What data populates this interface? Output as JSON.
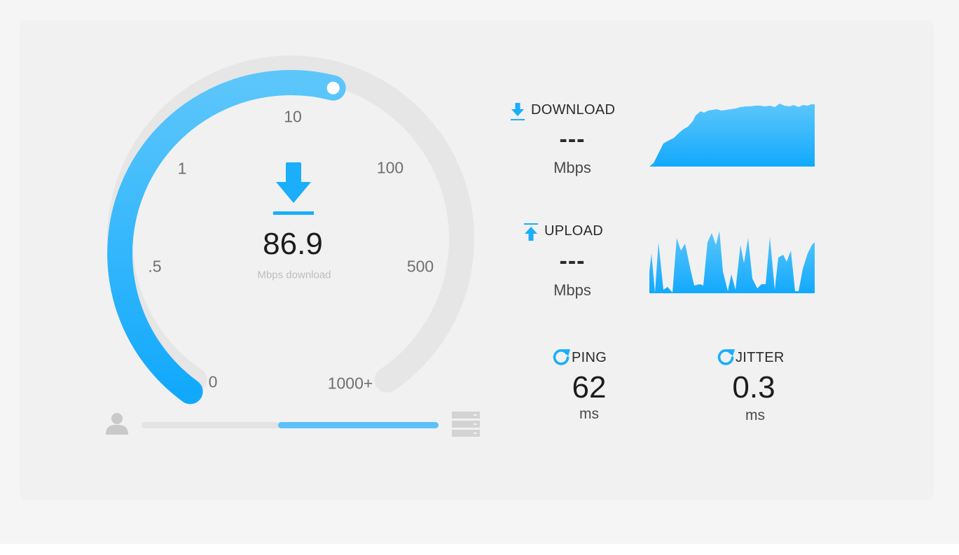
{
  "gauge": {
    "value": "86.9",
    "unit": "Mbps download",
    "level_fraction": 0.55,
    "ticks": [
      "0",
      ".5",
      "1",
      "10",
      "100",
      "500",
      "1000+"
    ],
    "icon": "download-arrow-icon",
    "colors": {
      "active": "#1aaefb",
      "track": "#e6e6e6"
    }
  },
  "download": {
    "label": "DOWNLOAD",
    "value": "---",
    "unit": "Mbps",
    "icon": "download-small-icon"
  },
  "upload": {
    "label": "UPLOAD",
    "value": "---",
    "unit": "Mbps",
    "icon": "upload-small-icon"
  },
  "ping": {
    "label": "PING",
    "value": "62",
    "unit": "ms",
    "icon": "refresh-icon"
  },
  "jitter": {
    "label": "JITTER",
    "value": "0.3",
    "unit": "ms",
    "icon": "refresh-icon"
  },
  "connection": {
    "progress_start": 0.46,
    "progress_end": 1.0,
    "client_icon": "user-icon",
    "server_icon": "server-icon"
  },
  "colors": {
    "accent": "#1aaefb",
    "text": "#1d1d1d"
  }
}
